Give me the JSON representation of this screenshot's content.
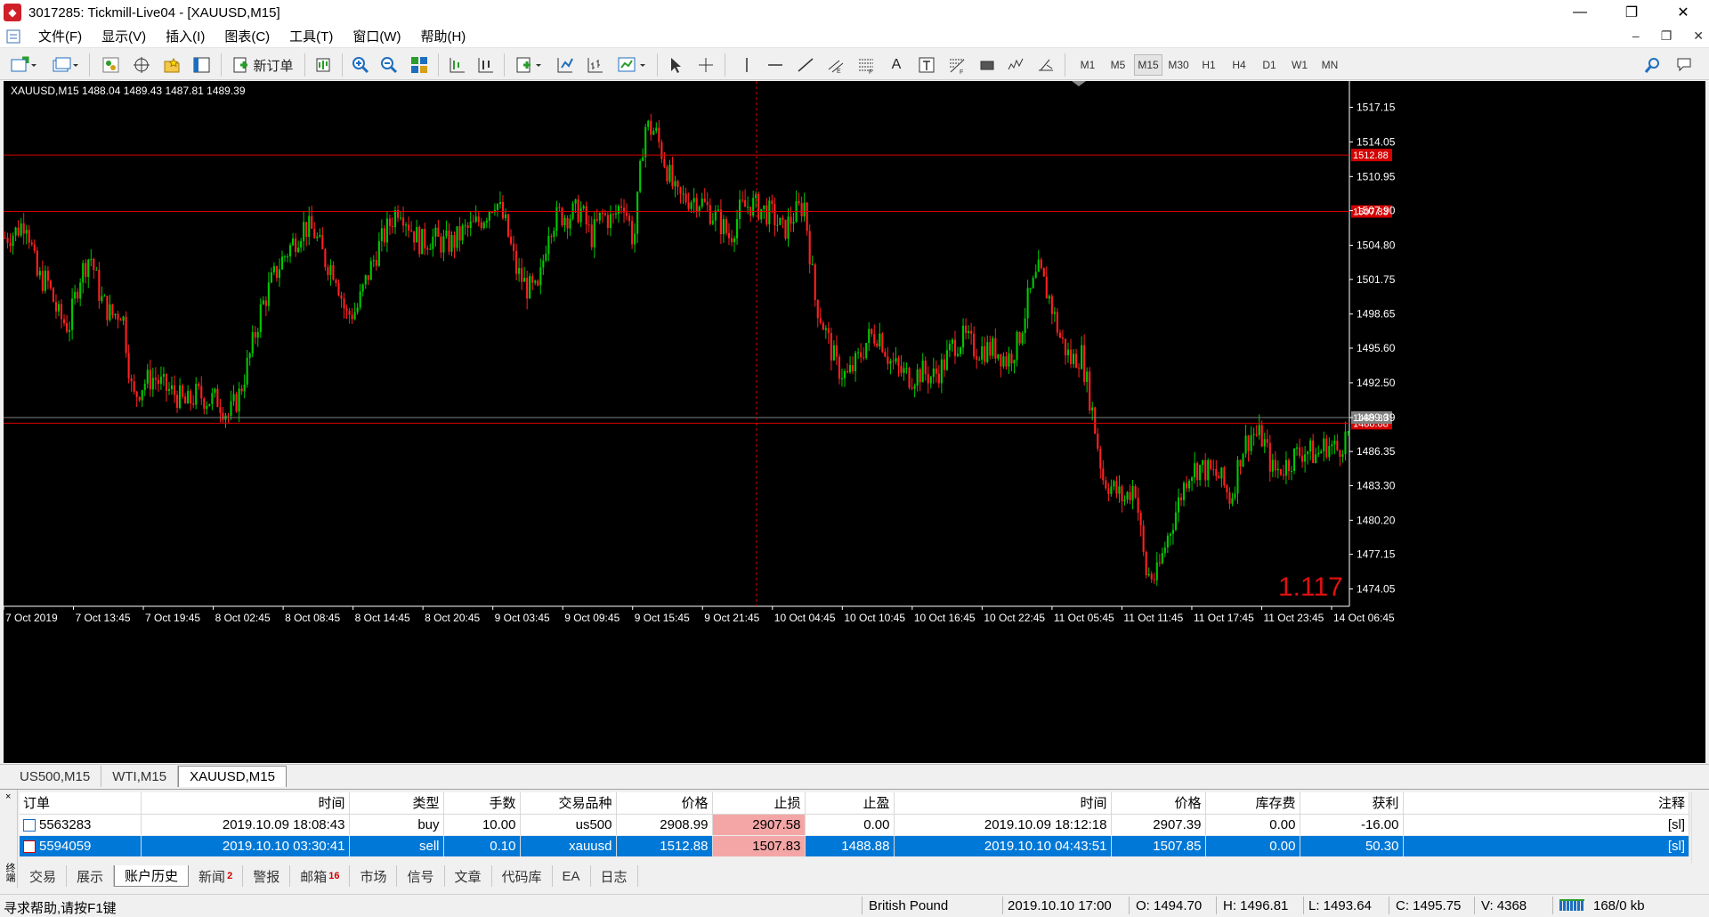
{
  "window": {
    "title": "3017285: Tickmill-Live04 - [XAUUSD,M15]",
    "controls": {
      "minimize": "—",
      "restore": "❐",
      "close": "✕"
    }
  },
  "menu": {
    "items": [
      "文件(F)",
      "显示(V)",
      "插入(I)",
      "图表(C)",
      "工具(T)",
      "窗口(W)",
      "帮助(H)"
    ],
    "mdi_controls": {
      "minimize": "–",
      "restore": "❐",
      "close": "✕"
    }
  },
  "toolbar": {
    "new_order_label": "新订单",
    "timeframes": [
      "M1",
      "M5",
      "M15",
      "M30",
      "H1",
      "H4",
      "D1",
      "W1",
      "MN"
    ],
    "active_timeframe": "M15",
    "text_tool": "A"
  },
  "chart": {
    "info": "XAUUSD,M15  1488.04 1489.43 1487.81 1489.39",
    "overlay_value": "1.117",
    "colors": {
      "bull": "#00c800",
      "bear": "#ff2020",
      "hline": "#d40000",
      "axis": "#ffffff",
      "background": "#000000"
    },
    "hlines": [
      {
        "price": 1512.88,
        "label": "1512.88",
        "color": "#d40000"
      },
      {
        "price": 1507.83,
        "label": "1507.83",
        "color": "#d40000"
      },
      {
        "price": 1488.88,
        "label": "1488.88",
        "color": "#d40000"
      },
      {
        "price": 1489.39,
        "label": "1489.39",
        "color": "#808080"
      }
    ],
    "crosshair_time": "9 Oct 23:00"
  },
  "chart_data": {
    "type": "candlestick",
    "symbol": "XAUUSD",
    "timeframe": "M15",
    "title": "XAUUSD,M15",
    "ylim": [
      1472.5,
      1519.5
    ],
    "y_ticks": [
      "1517.15",
      "1514.05",
      "1510.95",
      "1507.90",
      "1504.80",
      "1501.75",
      "1498.65",
      "1495.60",
      "1492.50",
      "1489.39",
      "1486.35",
      "1483.30",
      "1480.20",
      "1477.15",
      "1474.05"
    ],
    "x_ticks": [
      "7 Oct 2019",
      "7 Oct 13:45",
      "7 Oct 19:45",
      "8 Oct 02:45",
      "8 Oct 08:45",
      "8 Oct 14:45",
      "8 Oct 20:45",
      "9 Oct 03:45",
      "9 Oct 09:45",
      "9 Oct 15:45",
      "9 Oct 21:45",
      "10 Oct 04:45",
      "10 Oct 10:45",
      "10 Oct 16:45",
      "10 Oct 22:45",
      "11 Oct 05:45",
      "11 Oct 11:45",
      "11 Oct 17:45",
      "11 Oct 23:45",
      "14 Oct 06:45"
    ],
    "close_path": [
      1505.5,
      1506.0,
      1507.2,
      1502.0,
      1501.5,
      1498.5,
      1497.5,
      1502.0,
      1504.0,
      1500.0,
      1498.5,
      1499.0,
      1491.0,
      1492.5,
      1493.0,
      1492.0,
      1491.5,
      1490.5,
      1491.5,
      1491.0,
      1491.0,
      1489.5,
      1491.5,
      1495.0,
      1499.0,
      1501.5,
      1503.5,
      1505.0,
      1506.5,
      1506.0,
      1503.5,
      1502.5,
      1498.5,
      1499.0,
      1502.0,
      1504.5,
      1506.5,
      1508.5,
      1506.5,
      1505.0,
      1505.5,
      1505.0,
      1505.0,
      1506.0,
      1506.5,
      1507.5,
      1509.0,
      1506.5,
      1502.5,
      1501.0,
      1500.5,
      1506.5,
      1507.5,
      1507.5,
      1508.0,
      1505.5,
      1507.5,
      1507.0,
      1509.0,
      1505.0,
      1515.5,
      1515.0,
      1512.0,
      1509.0,
      1509.0,
      1509.0,
      1508.0,
      1507.0,
      1505.5,
      1508.0,
      1508.5,
      1508.0,
      1507.5,
      1506.0,
      1507.5,
      1508.5,
      1500.0,
      1497.0,
      1494.0,
      1493.0,
      1494.5,
      1496.5,
      1497.0,
      1494.5,
      1493.5,
      1493.0,
      1493.5,
      1493.0,
      1494.0,
      1496.0,
      1496.5,
      1495.5,
      1495.5,
      1495.5,
      1494.5,
      1496.0,
      1500.0,
      1502.5,
      1500.0,
      1496.5,
      1494.5,
      1495.0,
      1490.0,
      1484.0,
      1483.0,
      1482.0,
      1483.5,
      1475.5,
      1475.0,
      1478.5,
      1481.5,
      1484.5,
      1485.0,
      1484.5,
      1484.0,
      1482.0,
      1486.5,
      1488.0,
      1487.5,
      1484.5,
      1485.0,
      1486.0,
      1486.5,
      1486.0,
      1487.0,
      1486.5,
      1488.0
    ]
  },
  "chart_tabs": [
    "US500,M15",
    "WTI,M15",
    "XAUUSD,M15"
  ],
  "active_chart_tab": "XAUUSD,M15",
  "orders": {
    "columns": [
      "订单",
      "时间",
      "类型",
      "手数",
      "交易品种",
      "价格",
      "止损",
      "止盈",
      "时间",
      "价格",
      "库存费",
      "获利",
      "注释"
    ],
    "rows": [
      {
        "ticket": "5563283",
        "open_time": "2019.10.09 18:08:43",
        "type": "buy",
        "lots": "10.00",
        "symbol": "us500",
        "open_price": "2908.99",
        "sl": "2907.58",
        "tp": "0.00",
        "close_time": "2019.10.09 18:12:18",
        "close_price": "2907.39",
        "swap": "0.00",
        "profit": "-16.00",
        "comment": "[sl]"
      },
      {
        "ticket": "5594059",
        "open_time": "2019.10.10 03:30:41",
        "type": "sell",
        "lots": "0.10",
        "symbol": "xauusd",
        "open_price": "1512.88",
        "sl": "1507.83",
        "tp": "1488.88",
        "close_time": "2019.10.10 04:43:51",
        "close_price": "1507.85",
        "swap": "0.00",
        "profit": "50.30",
        "comment": "[sl]"
      }
    ],
    "selected_row": 1
  },
  "terminal": {
    "close_x": "×",
    "side_label": "终端",
    "tabs": [
      {
        "label": "交易",
        "badge": ""
      },
      {
        "label": "展示",
        "badge": ""
      },
      {
        "label": "账户历史",
        "badge": ""
      },
      {
        "label": "新闻",
        "badge": "2"
      },
      {
        "label": "警报",
        "badge": ""
      },
      {
        "label": "邮箱",
        "badge": "16"
      },
      {
        "label": "市场",
        "badge": ""
      },
      {
        "label": "信号",
        "badge": ""
      },
      {
        "label": "文章",
        "badge": ""
      },
      {
        "label": "代码库",
        "badge": ""
      },
      {
        "label": "EA",
        "badge": ""
      },
      {
        "label": "日志",
        "badge": ""
      }
    ],
    "active_tab": "账户历史"
  },
  "status": {
    "help": "寻求帮助,请按F1键",
    "profile": "British Pound",
    "datetime": "2019.10.10 17:00",
    "open": "O: 1494.70",
    "high": "H: 1496.81",
    "low": "L: 1493.64",
    "close": "C: 1495.75",
    "volume": "V: 4368",
    "traffic": "168/0 kb"
  }
}
